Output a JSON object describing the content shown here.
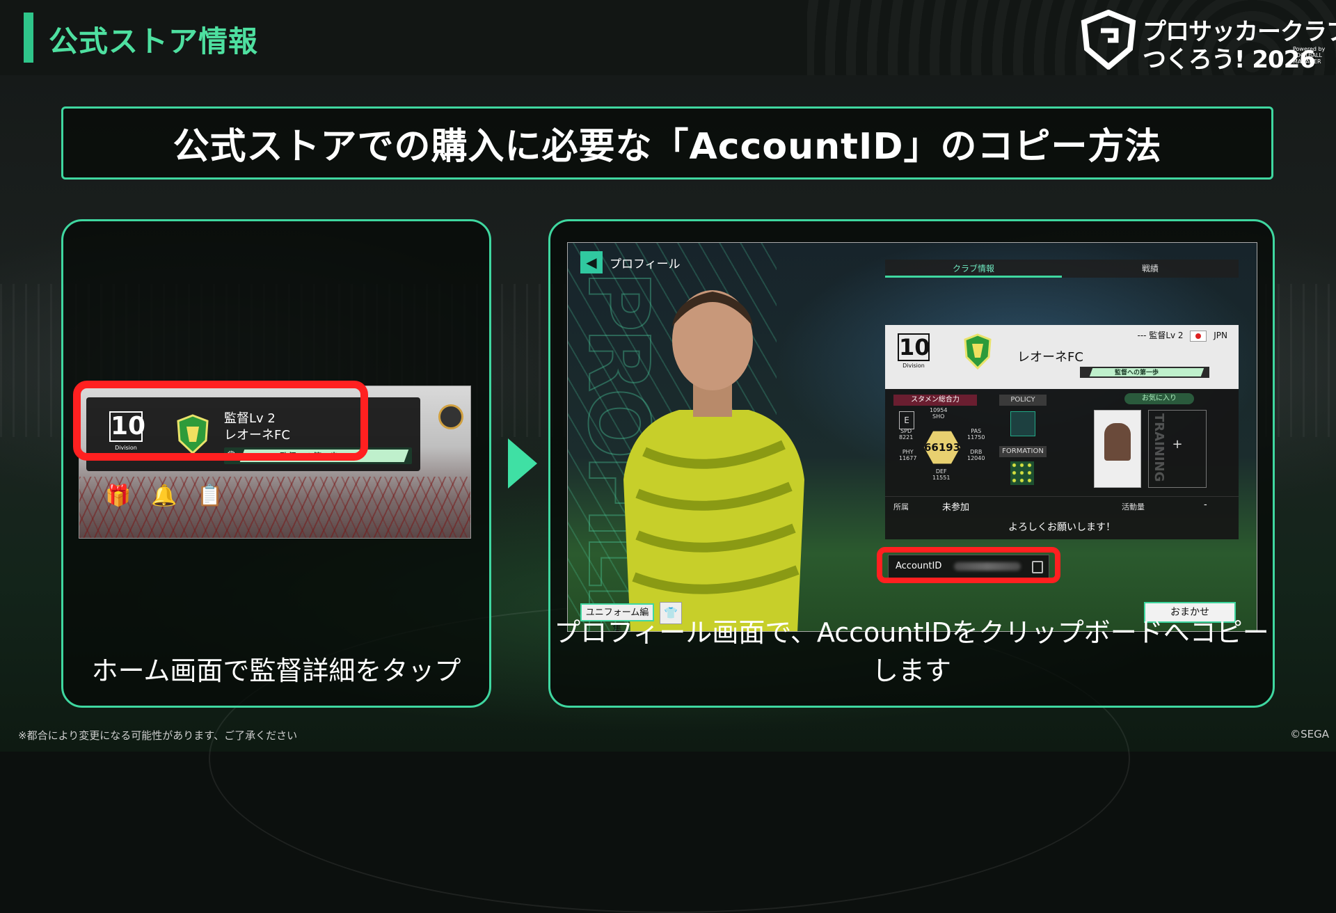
{
  "header": {
    "title": "公式ストア情報",
    "logo": {
      "line1": "プロサッカークラブを",
      "line2": "つくろう! 2026",
      "powered": "Powered by FOOTBALL MANAGER"
    }
  },
  "banner": {
    "text": "公式ストアでの購入に必要な「AccountID」のコピー方法"
  },
  "left_panel": {
    "caption": "ホーム画面で監督詳細をタップ",
    "screenshot": {
      "division_number": "10",
      "division_label": "Division",
      "manager_level": "監督Lv 2",
      "club_name": "レオーネFC",
      "progress_label": "監督への第一歩",
      "icons": [
        "gift-icon",
        "bell-icon",
        "clipboard-icon"
      ]
    }
  },
  "right_panel": {
    "caption": "プロフィール画面で、AccountIDをクリップボードへコピーします",
    "screenshot": {
      "back_label": "プロフィール",
      "tabs": [
        "クラブ情報",
        "戦績"
      ],
      "division_number": "10",
      "division_label": "Division",
      "club_name": "レオーネFC",
      "meta_dashes": "---",
      "manager_level": "監督Lv 2",
      "country": "JPN",
      "progress_label": "監督への第一歩",
      "starting_power_label": "スタメン総合力",
      "rank_letter": "E",
      "total_power": "66193",
      "stats": {
        "sho_value": "10954",
        "sho_label": "SHO",
        "pas_label": "PAS",
        "pas_value": "11750",
        "spd_label": "SPD",
        "spd_value": "8221",
        "drb_label": "DRB",
        "drb_value": "12040",
        "phy_label": "PHY",
        "phy_value": "11677",
        "def_label": "DEF",
        "def_value": "11551"
      },
      "policy_label": "POLICY",
      "formation_label": "FORMATION",
      "favorite_label": "お気に入り",
      "training_label": "TRAINING",
      "plus": "+",
      "affiliation_label": "所属",
      "affiliation_value": "未参加",
      "activity_label": "活動量",
      "activity_value": "-",
      "greeting": "よろしくお願いします！",
      "account_label": "AccountID",
      "uniform_button": "ユニフォーム編集",
      "auto_button": "おまかせ"
    }
  },
  "footer": {
    "note": "※都合により変更になる可能性があります、ご了承ください",
    "copyright": "©SEGA"
  },
  "colors": {
    "accent": "#3fd7a0",
    "title_green": "#4ee0a0",
    "highlight_red": "#ff2020"
  }
}
